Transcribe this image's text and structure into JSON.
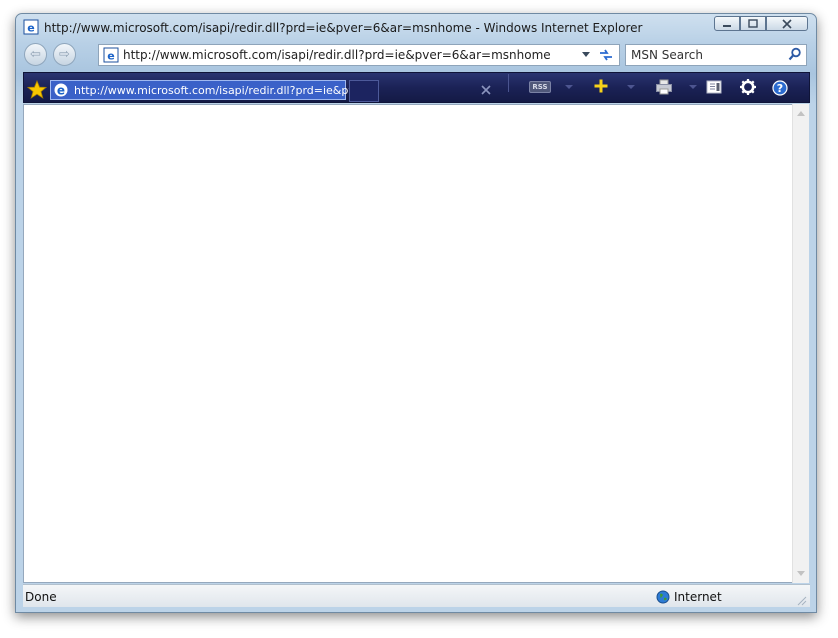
{
  "window": {
    "title": "http://www.microsoft.com/isapi/redir.dll?prd=ie&pver=6&ar=msnhome - Windows Internet Explorer"
  },
  "address_bar": {
    "url": "http://www.microsoft.com/isapi/redir.dll?prd=ie&pver=6&ar=msnhome"
  },
  "search": {
    "placeholder": "MSN Search"
  },
  "tab": {
    "url": "http://www.microsoft.com/isapi/redir.dll?prd=ie&pve"
  },
  "toolbar": {
    "rss_label": "RSS"
  },
  "status": {
    "text": "Done",
    "zone": "Internet"
  },
  "colors": {
    "command_bar": "#1b2256",
    "tab_highlight": "#3a61c8",
    "favorites_star": "#f7c600",
    "add_favorite": "#f7d21a"
  }
}
